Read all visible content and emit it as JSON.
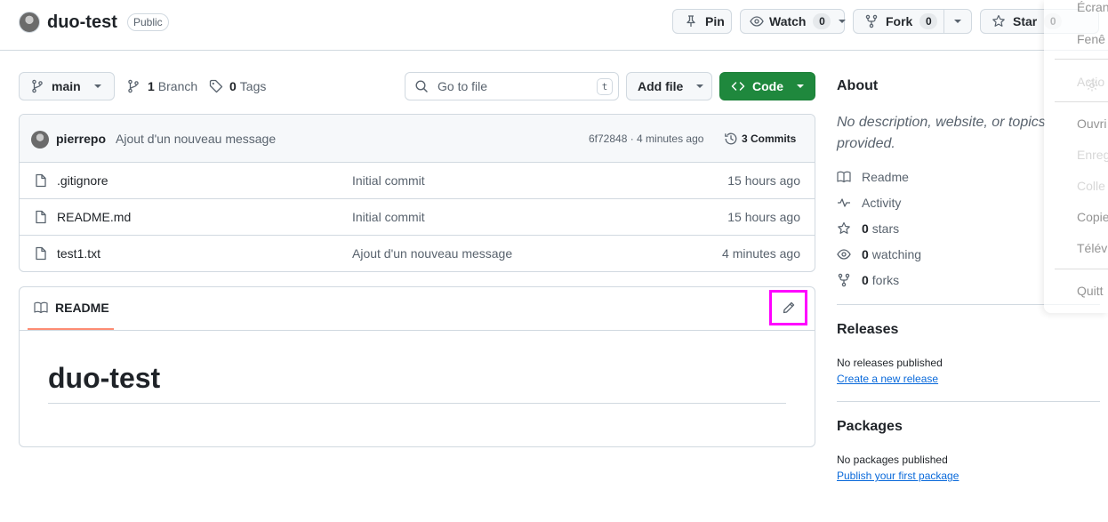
{
  "repo": {
    "name": "duo-test",
    "visibility": "Public"
  },
  "actions": {
    "pin_label": "Pin",
    "watch_label": "Watch",
    "watch_count": "0",
    "fork_label": "Fork",
    "fork_count": "0",
    "star_label": "Star",
    "star_count": "0"
  },
  "toolbar": {
    "branch": "main",
    "branch_count": "1",
    "branch_label": "Branch",
    "tag_count": "0",
    "tag_label": "Tags",
    "go_to_file_placeholder": "Go to file",
    "go_to_file_shortcut": "t",
    "add_file_label": "Add file",
    "code_label": "Code"
  },
  "latest_commit": {
    "author": "pierrepo",
    "message": "Ajout d'un nouveau message",
    "sha_time": "6f72848 · 4 minutes ago",
    "commits_label": "3 Commits"
  },
  "files": [
    {
      "name": ".gitignore",
      "message": "Initial commit",
      "time": "15 hours ago"
    },
    {
      "name": "README.md",
      "message": "Initial commit",
      "time": "15 hours ago"
    },
    {
      "name": "test1.txt",
      "message": "Ajout d'un nouveau message",
      "time": "4 minutes ago"
    }
  ],
  "readme": {
    "tab_label": "README",
    "heading": "duo-test"
  },
  "about": {
    "title": "About",
    "description": "No description, website, or topics provided.",
    "items": [
      {
        "icon": "book-icon",
        "bold": "",
        "label": "Readme"
      },
      {
        "icon": "pulse-icon",
        "bold": "",
        "label": "Activity"
      },
      {
        "icon": "star-icon",
        "bold": "0",
        "label": "stars"
      },
      {
        "icon": "eye-icon",
        "bold": "0",
        "label": "watching"
      },
      {
        "icon": "fork-icon",
        "bold": "0",
        "label": "forks"
      }
    ]
  },
  "releases": {
    "title": "Releases",
    "empty_text": "No releases published",
    "link": "Create a new release"
  },
  "packages": {
    "title": "Packages",
    "empty_text": "No packages published",
    "link": "Publish your first package"
  },
  "overlay_menu": {
    "items": [
      "Écran",
      "Fenê",
      "Actio",
      "Ouvri",
      "Enreg",
      "Colle",
      "Copie",
      "Télév",
      "Quitt"
    ]
  },
  "colors": {
    "accent_green": "#1f883d",
    "link_blue": "#0969da",
    "highlight_magenta": "#ff00ff",
    "readme_underline": "#fd8c73"
  }
}
